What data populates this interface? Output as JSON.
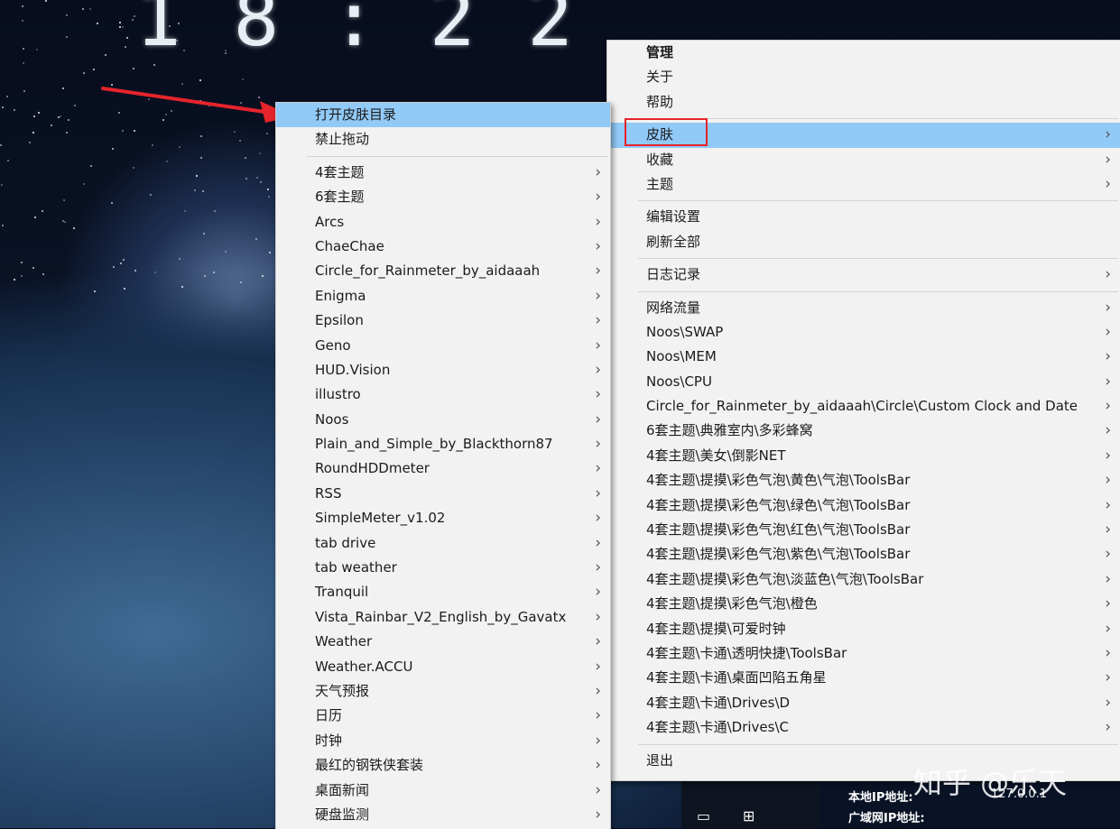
{
  "desktop": {
    "clock_text": "18:22",
    "bottom_info": {
      "local_ip_label": "本地IP地址:",
      "local_ip_value": "127.0.0.1",
      "wan_ip_label": "广域网IP地址:"
    },
    "watermark": "知乎 @乐天",
    "colors": {
      "menu_bg": "#f2f2f2",
      "highlight": "#91c9f7",
      "red_marker": "#e6242b"
    }
  },
  "main_menu": {
    "items": [
      {
        "label": "管理",
        "submenu": false
      },
      {
        "label": "关于",
        "submenu": false
      },
      {
        "label": "帮助",
        "submenu": false
      },
      {
        "separator": true
      },
      {
        "label": "皮肤",
        "submenu": true,
        "highlighted": true
      },
      {
        "label": "收藏",
        "submenu": true
      },
      {
        "label": "主题",
        "submenu": true
      },
      {
        "separator": true
      },
      {
        "label": "编辑设置",
        "submenu": false
      },
      {
        "label": "刷新全部",
        "submenu": false
      },
      {
        "separator": true
      },
      {
        "label": "日志记录",
        "submenu": true
      },
      {
        "separator": true
      },
      {
        "label": "网络流量",
        "submenu": true
      },
      {
        "label": "Noos\\SWAP",
        "submenu": true
      },
      {
        "label": "Noos\\MEM",
        "submenu": true
      },
      {
        "label": "Noos\\CPU",
        "submenu": true
      },
      {
        "label": "Circle_for_Rainmeter_by_aidaaah\\Circle\\Custom Clock and Date",
        "submenu": true
      },
      {
        "label": "6套主题\\典雅室内\\多彩蜂窝",
        "submenu": true
      },
      {
        "label": "4套主题\\美女\\倒影NET",
        "submenu": true
      },
      {
        "label": "4套主题\\提摸\\彩色气泡\\黄色\\气泡\\ToolsBar",
        "submenu": true
      },
      {
        "label": "4套主题\\提摸\\彩色气泡\\绿色\\气泡\\ToolsBar",
        "submenu": true
      },
      {
        "label": "4套主题\\提摸\\彩色气泡\\红色\\气泡\\ToolsBar",
        "submenu": true
      },
      {
        "label": "4套主题\\提摸\\彩色气泡\\紫色\\气泡\\ToolsBar",
        "submenu": true
      },
      {
        "label": "4套主题\\提摸\\彩色气泡\\淡蓝色\\气泡\\ToolsBar",
        "submenu": true
      },
      {
        "label": "4套主题\\提摸\\彩色气泡\\橙色",
        "submenu": true
      },
      {
        "label": "4套主题\\提摸\\可爱时钟",
        "submenu": true
      },
      {
        "label": "4套主题\\卡通\\透明快捷\\ToolsBar",
        "submenu": true
      },
      {
        "label": "4套主题\\卡通\\桌面凹陷五角星",
        "submenu": true
      },
      {
        "label": "4套主题\\卡通\\Drives\\D",
        "submenu": true
      },
      {
        "label": "4套主题\\卡通\\Drives\\C",
        "submenu": true
      },
      {
        "separator": true
      },
      {
        "label": "退出",
        "submenu": false
      }
    ]
  },
  "skins_menu": {
    "items": [
      {
        "label": "打开皮肤目录",
        "submenu": false,
        "highlighted": true
      },
      {
        "label": "禁止拖动",
        "submenu": false
      },
      {
        "separator": true
      },
      {
        "label": "4套主题",
        "submenu": true
      },
      {
        "label": "6套主题",
        "submenu": true
      },
      {
        "label": "Arcs",
        "submenu": true
      },
      {
        "label": "ChaeChae",
        "submenu": true
      },
      {
        "label": "Circle_for_Rainmeter_by_aidaaah",
        "submenu": true
      },
      {
        "label": "Enigma",
        "submenu": true
      },
      {
        "label": "Epsilon",
        "submenu": true
      },
      {
        "label": "Geno",
        "submenu": true
      },
      {
        "label": "HUD.Vision",
        "submenu": true
      },
      {
        "label": "illustro",
        "submenu": true
      },
      {
        "label": "Noos",
        "submenu": true
      },
      {
        "label": "Plain_and_Simple_by_Blackthorn87",
        "submenu": true
      },
      {
        "label": "RoundHDDmeter",
        "submenu": true
      },
      {
        "label": "RSS",
        "submenu": true
      },
      {
        "label": "SimpleMeter_v1.02",
        "submenu": true
      },
      {
        "label": "tab drive",
        "submenu": true
      },
      {
        "label": "tab weather",
        "submenu": true
      },
      {
        "label": "Tranquil",
        "submenu": true
      },
      {
        "label": "Vista_Rainbar_V2_English_by_Gavatx",
        "submenu": true
      },
      {
        "label": "Weather",
        "submenu": true
      },
      {
        "label": "Weather.ACCU",
        "submenu": true
      },
      {
        "label": "天气预报",
        "submenu": true
      },
      {
        "label": "日历",
        "submenu": true
      },
      {
        "label": "时钟",
        "submenu": true
      },
      {
        "label": "最红的钢铁侠套装",
        "submenu": true
      },
      {
        "label": "桌面新闻",
        "submenu": true
      },
      {
        "label": "硬盘监测",
        "submenu": true
      }
    ]
  }
}
